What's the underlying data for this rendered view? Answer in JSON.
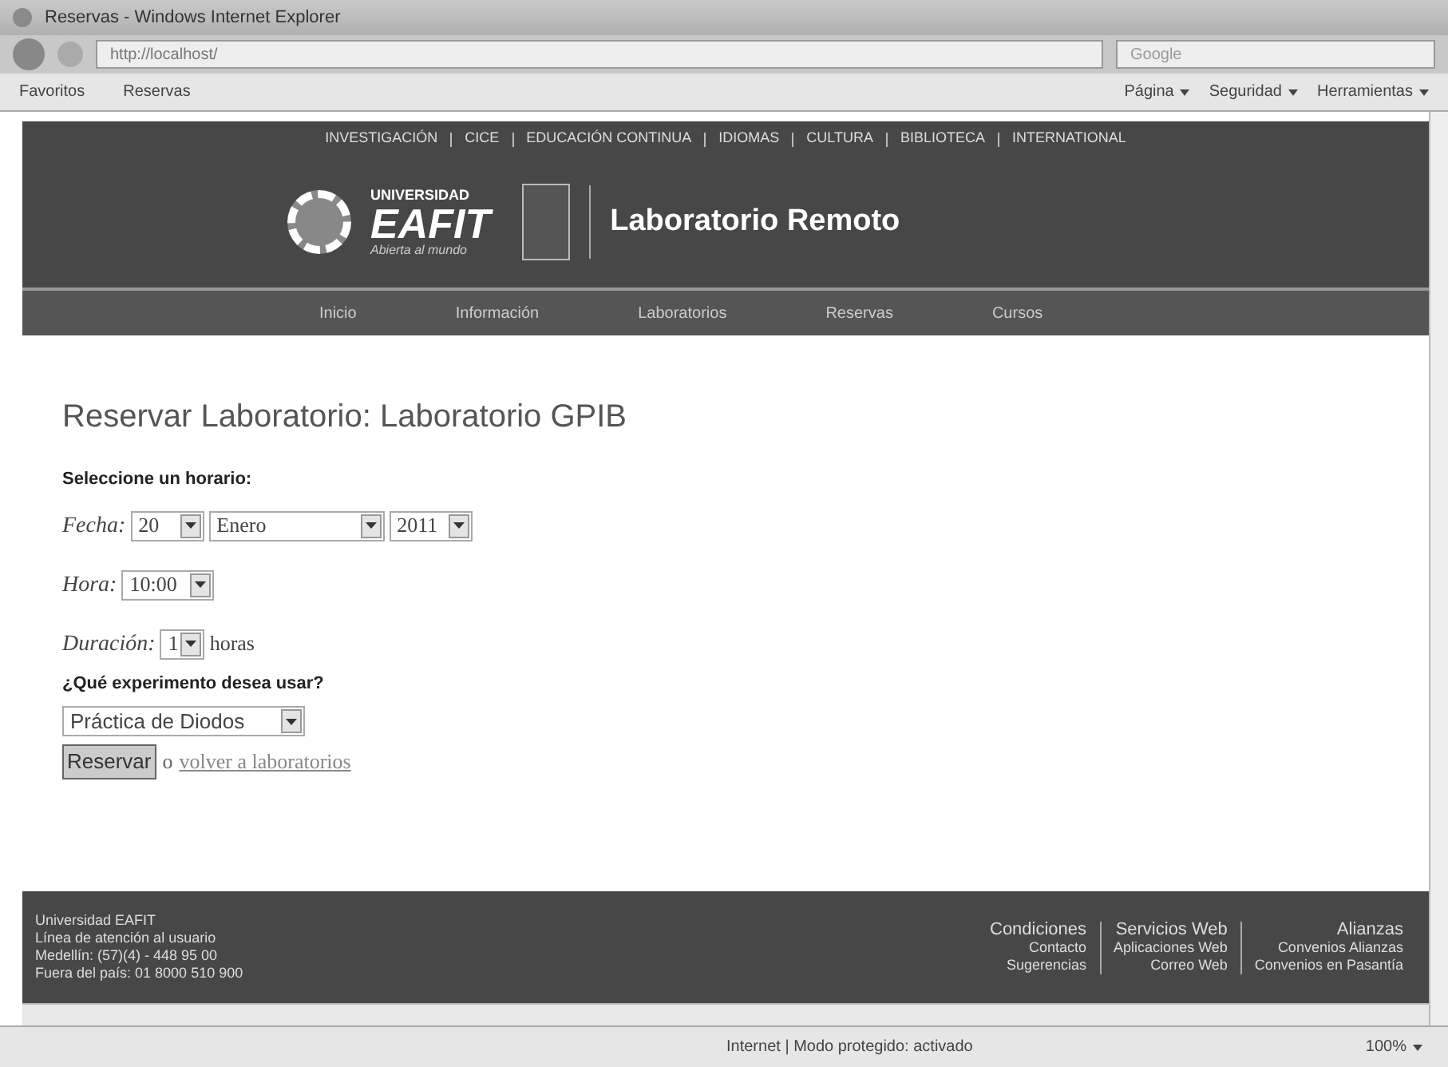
{
  "window": {
    "title": "Reservas - Windows Internet Explorer"
  },
  "address_bar": {
    "url": "http://localhost/",
    "search_placeholder": "Google"
  },
  "favorites_bar": {
    "items": [
      "Favoritos",
      "Reservas"
    ],
    "commands": [
      "Página",
      "Seguridad",
      "Herramientas"
    ]
  },
  "page": {
    "top_links": [
      "INVESTIGACIÓN",
      "CICE",
      "EDUCACIÓN CONTINUA",
      "IDIOMAS",
      "CULTURA",
      "BIBLIOTECA",
      "INTERNATIONAL"
    ],
    "logo": {
      "top": "UNIVERSIDAD",
      "name": "EAFIT",
      "tagline": "Abierta al mundo"
    },
    "site_title": "Laboratorio Remoto",
    "nav": [
      {
        "label": "Inicio",
        "selected": false
      },
      {
        "label": "Información",
        "selected": false
      },
      {
        "label": "Laboratorios",
        "selected": false
      },
      {
        "label": "Reservas",
        "selected": false
      },
      {
        "label": "Cursos",
        "selected": false
      }
    ],
    "heading": "Reservar Laboratorio: Laboratorio GPIB",
    "schedule_label": "Seleccione un horario:",
    "fecha": {
      "label": "Fecha:",
      "day": "20",
      "month": "Enero",
      "year": "2011"
    },
    "hora": {
      "label": "Hora:",
      "value": "10:00"
    },
    "duracion": {
      "label": "Duración:",
      "value": "1",
      "unit": "horas"
    },
    "experiment_label": "¿Qué experimento desea usar?",
    "experiment": "Práctica de Diodos",
    "submit": "Reservar",
    "or": "o",
    "back_link": "volver a laboratorios",
    "footer": {
      "address": [
        "Universidad EAFIT",
        "Línea de atención al usuario",
        "Medellín: (57)(4) - 448 95 00",
        "Fuera del país: 01 8000 510 900"
      ],
      "columns": [
        [
          "Condiciones",
          "Contacto",
          "Sugerencias"
        ],
        [
          "Servicios Web",
          "Aplicaciones Web",
          "Correo Web"
        ],
        [
          "Alianzas",
          "Convenios Alianzas",
          "Convenios en Pasantía"
        ]
      ]
    }
  },
  "status_bar": {
    "zone": "Internet | Modo protegido: activado",
    "zoom": "100%"
  }
}
